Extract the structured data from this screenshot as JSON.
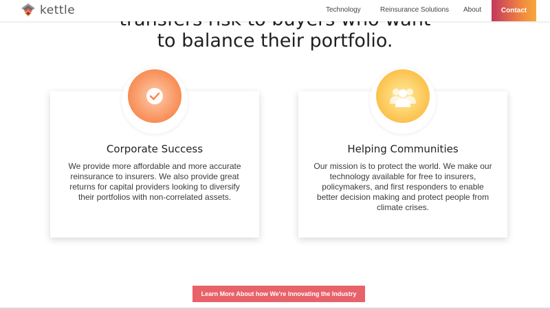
{
  "header": {
    "logo_text": "kettle",
    "nav": {
      "technology": "Technology",
      "reinsurance": "Reinsurance Solutions",
      "about": "About"
    },
    "contact_label": "Contact",
    "contact_gradient": [
      "#c2375e",
      "#f5a93a"
    ]
  },
  "hero": {
    "line1": "transfers risk to buyers who want",
    "line2": "to balance their portfolio."
  },
  "cards": [
    {
      "icon": "checkmark-icon",
      "accent": "#f47c3e",
      "title": "Corporate Success",
      "body": "We provide more affordable and more accurate reinsurance to insurers. We also provide great returns for capital providers looking to diversify their portfolios with non-correlated assets."
    },
    {
      "icon": "people-icon",
      "accent": "#fbb13e",
      "title": "Helping Communities",
      "body": "Our mission is to protect the world. We make our technology available for free to insurers, policymakers, and first responders to enable better decision making and protect people from climate crises."
    }
  ],
  "cta": {
    "label": "Learn More About how We're Innovating the Industry",
    "color": "#e8626a"
  }
}
